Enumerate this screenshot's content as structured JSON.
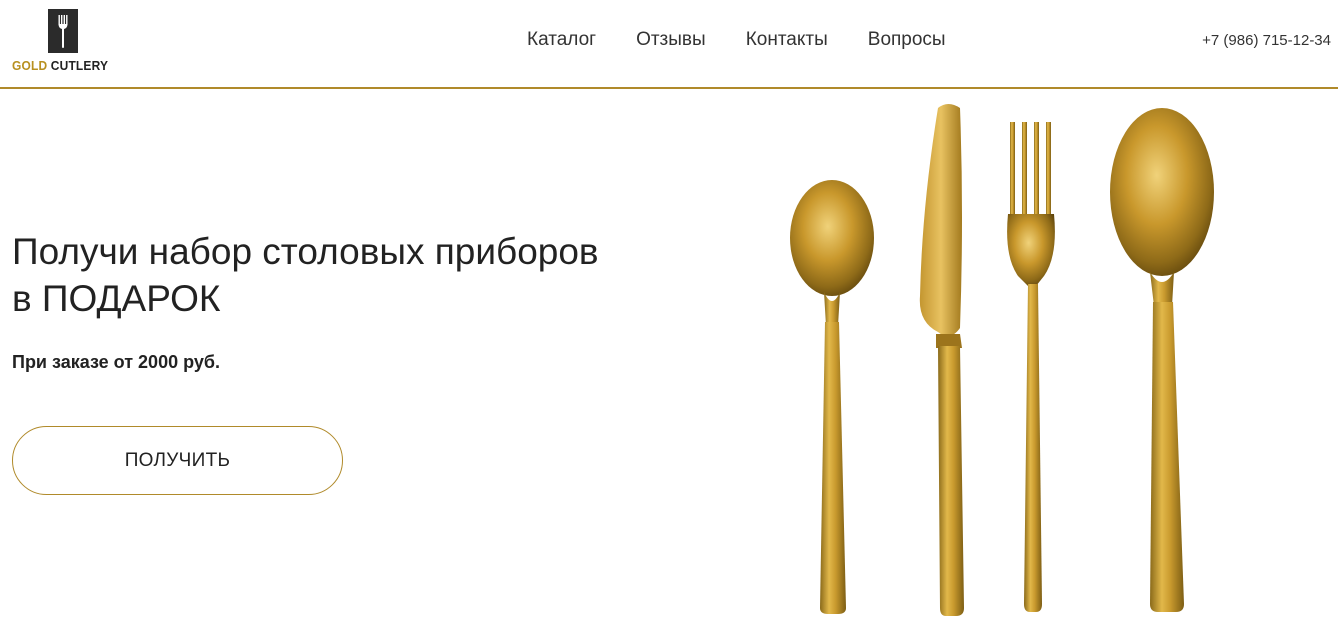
{
  "brand": {
    "name_gold": "GOLD",
    "name_dark": " CUTLERY",
    "logo_icon": "fork-icon",
    "accent_color": "#b08a2a"
  },
  "nav": {
    "items": [
      {
        "label": "Каталог"
      },
      {
        "label": "Отзывы"
      },
      {
        "label": "Контакты"
      },
      {
        "label": "Вопросы"
      }
    ]
  },
  "contact": {
    "phone": "+7 (986) 715-12-34"
  },
  "hero": {
    "title_line1": "Получи набор столовых приборов",
    "title_line2": "в ПОДАРОК",
    "subtitle": "При заказе от 2000 руб.",
    "cta_label": "ПОЛУЧИТЬ",
    "image_subject": "gold-cutlery-set"
  }
}
